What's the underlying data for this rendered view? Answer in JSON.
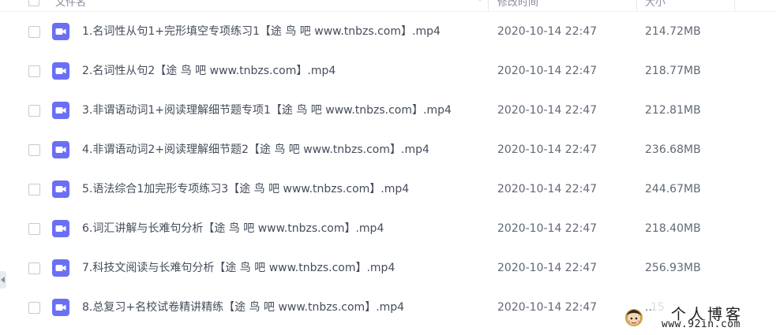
{
  "header": {
    "col_name": "文件名",
    "col_time": "修改时间",
    "col_size": "大小"
  },
  "icons": {
    "file_type": "video-file-icon",
    "accent": "#6b6ff4"
  },
  "files": [
    {
      "name": "1.名词性从句1+完形填空专项练习1【途 鸟 吧 www.tnbzs.com】.mp4",
      "time": "2020-10-14 22:47",
      "size": "214.72MB"
    },
    {
      "name": "2.名词性从句2【途 鸟 吧 www.tnbzs.com】.mp4",
      "time": "2020-10-14 22:47",
      "size": "218.77MB"
    },
    {
      "name": "3.非谓语动词1+阅读理解细节题专项1【途 鸟 吧 www.tnbzs.com】.mp4",
      "time": "2020-10-14 22:47",
      "size": "212.81MB"
    },
    {
      "name": "4.非谓语动词2+阅读理解细节题2【途 鸟 吧 www.tnbzs.com】.mp4",
      "time": "2020-10-14 22:47",
      "size": "236.68MB"
    },
    {
      "name": "5.语法综合1加完形专项练习3【途 鸟 吧 www.tnbzs.com】.mp4",
      "time": "2020-10-14 22:47",
      "size": "244.67MB"
    },
    {
      "name": "6.词汇讲解与长难句分析【途 鸟 吧 www.tnbzs.com】.mp4",
      "time": "2020-10-14 22:47",
      "size": "218.40MB"
    },
    {
      "name": "7.科技文阅读与长难句分析【途 鸟 吧 www.tnbzs.com】.mp4",
      "time": "2020-10-14 22:47",
      "size": "256.93MB"
    },
    {
      "name": "8.总复习+名校试卷精讲精练【途 鸟 吧 www.tnbzs.com】.mp4",
      "time": "2020-10-14 22:47",
      "size": "..."
    }
  ],
  "watermark": {
    "ghost_text": "15",
    "title": "个人博客",
    "url": "www.92in.com"
  }
}
